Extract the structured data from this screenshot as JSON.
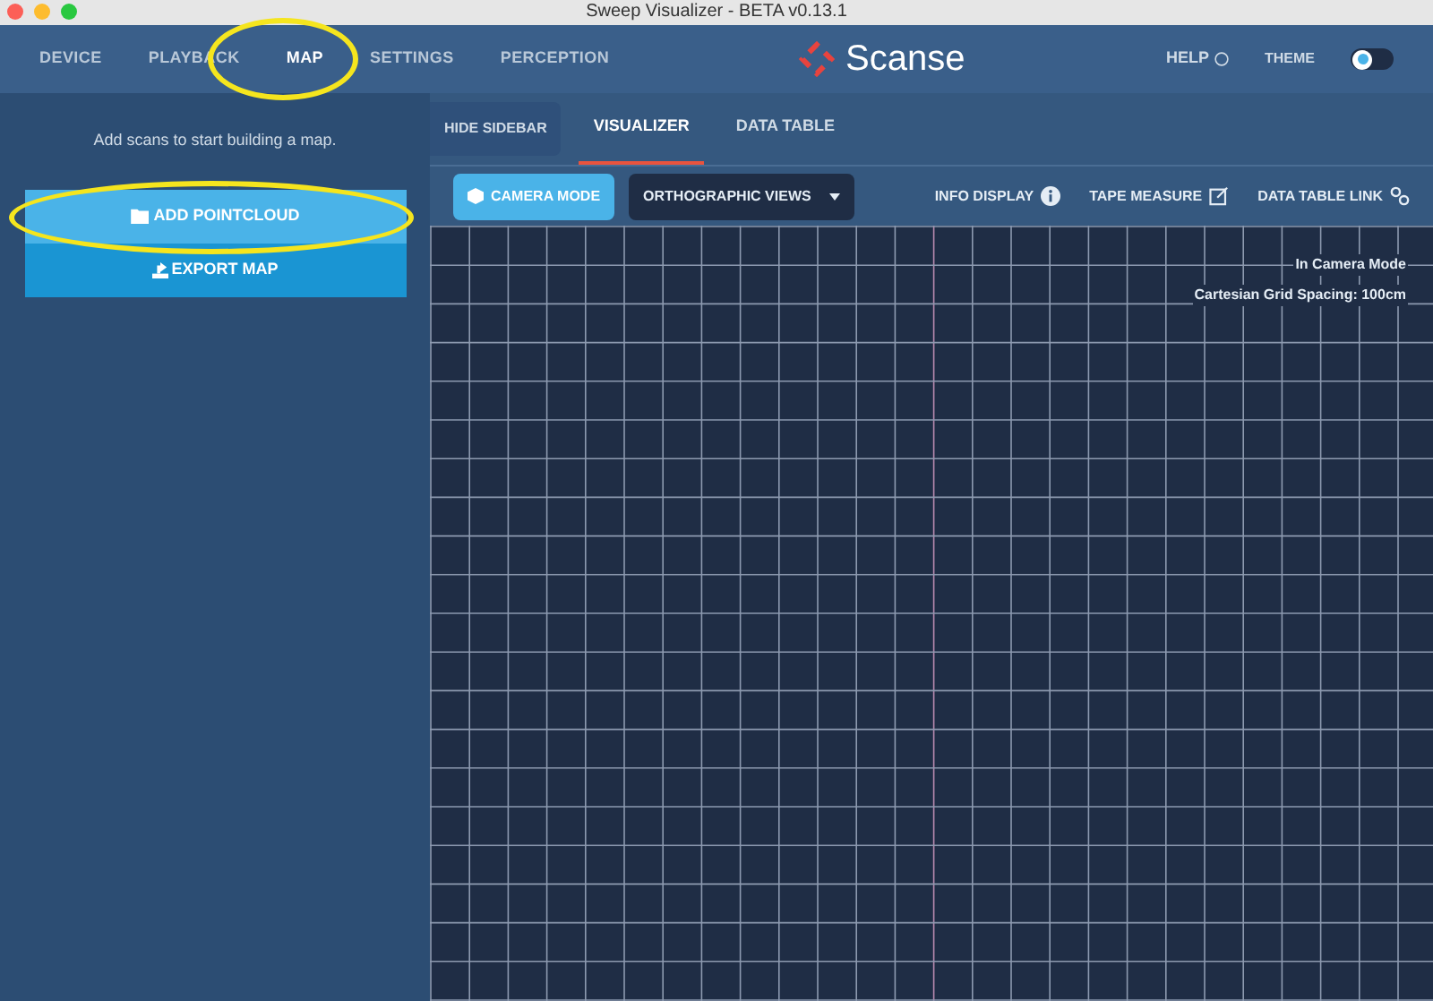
{
  "window": {
    "title": "Sweep Visualizer - BETA v0.13.1"
  },
  "nav": [
    {
      "label": "DEVICE",
      "selected": false
    },
    {
      "label": "PLAYBACK",
      "selected": false
    },
    {
      "label": "MAP",
      "selected": true
    },
    {
      "label": "SETTINGS",
      "selected": false
    },
    {
      "label": "PERCEPTION",
      "selected": false
    }
  ],
  "logo": {
    "text": "Scanse"
  },
  "help": {
    "label": "HELP"
  },
  "theme": {
    "label": "THEME",
    "on": false
  },
  "sidebar": {
    "message": "Add scans to start building a map.",
    "buttons": [
      {
        "label": "ADD POINTCLOUD",
        "kind": "add"
      },
      {
        "label": "EXPORT MAP",
        "kind": "export"
      }
    ]
  },
  "view_tabs": [
    {
      "label": "HIDE SIDEBAR",
      "kind": "button",
      "selected": false
    },
    {
      "label": "VISUALIZER",
      "kind": "tab",
      "selected": true
    },
    {
      "label": "DATA TABLE",
      "kind": "tab",
      "selected": false
    }
  ],
  "toolbar": {
    "camera_mode": {
      "label": "CAMERA MODE",
      "selected": true
    },
    "views": {
      "label": "ORTHOGRAPHIC VIEWS"
    },
    "tools": [
      {
        "label": "INFO DISPLAY",
        "kind": "info"
      },
      {
        "label": "TAPE MEASURE",
        "kind": "edit"
      },
      {
        "label": "DATA TABLE LINK",
        "kind": "link"
      }
    ]
  },
  "canvas": {
    "info": [
      "In Camera Mode",
      "Cartesian Grid Spacing: 100cm"
    ]
  }
}
